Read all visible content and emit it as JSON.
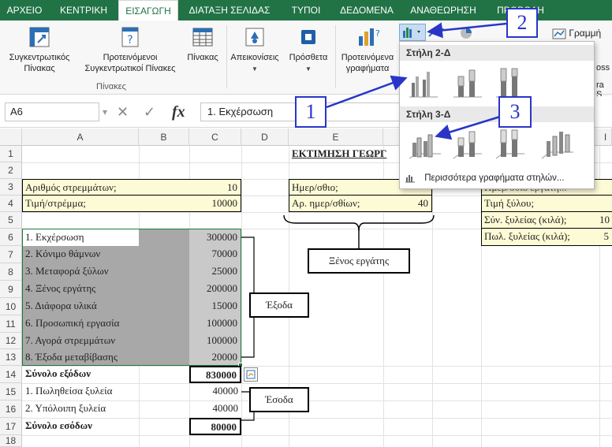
{
  "tabs": [
    {
      "label": "ΑΡΧΕΙΟ",
      "active": false
    },
    {
      "label": "ΚΕΝΤΡΙΚΗ",
      "active": false
    },
    {
      "label": "ΕΙΣΑΓΩΓΗ",
      "active": true
    },
    {
      "label": "ΔΙΑΤΑΞΗ ΣΕΛΙΔΑΣ",
      "active": false
    },
    {
      "label": "ΤΥΠΟΙ",
      "active": false
    },
    {
      "label": "ΔΕΔΟΜΕΝΑ",
      "active": false
    },
    {
      "label": "ΑΝΑΘΕΩΡΗΣΗ",
      "active": false
    },
    {
      "label": "ΠΡΟΒΟΛΗ",
      "active": false
    }
  ],
  "ribbon": {
    "pivot_line1": "Συγκεντρωτικός",
    "pivot_line2": "Πίνακας",
    "recpivot_line1": "Προτεινόμενοι",
    "recpivot_line2": "Συγκεντρωτικοί Πίνακες",
    "table_label": "Πίνακας",
    "tables_group": "Πίνακες",
    "illustrations_label": "Απεικονίσεις",
    "addins_label": "Πρόσθετα",
    "recchart_line1": "Προτεινόμενα",
    "recchart_line2": "γραφήματα",
    "line_chart_label": "Γραμμή",
    "cut_off_1": "oss",
    "cut_off_2": "ra S..."
  },
  "formula_bar": {
    "name_box": "A6",
    "fx": "fx",
    "cancel": "✕",
    "enter": "✓",
    "formula": "1. Εκχέρσωση"
  },
  "columns": [
    "A",
    "B",
    "C",
    "D",
    "E",
    "I"
  ],
  "rows": [
    "1",
    "2",
    "3",
    "4",
    "5",
    "6",
    "7",
    "8",
    "9",
    "10",
    "11",
    "12",
    "13",
    "14",
    "15",
    "16",
    "17",
    "18"
  ],
  "sheet": {
    "title": "ΕΚΤΙΜΗΣΗ ΓΕΩΡΓ",
    "area_label": "Αριθμός στρεμμάτων;",
    "area_value": "10",
    "price_label": "Τιμή/στρέμμα;",
    "price_value": "10000",
    "daily_label": "Ημερ/σθιο;",
    "days_label": "Αρ. ημερ/σθίων;",
    "days_value": "40",
    "right_r3": "Ημερ/σθιο εργάτη...",
    "right_r4": "Τιμή ξύλου;",
    "right_r5": "Σύν. ξυλείας (κιλά);",
    "right_r5_val": "10",
    "right_r6": "Πωλ. ξυλείας (κιλά);",
    "right_r6_val": "5",
    "expenses": [
      {
        "label": "1. Εκχέρσωση",
        "value": "300000"
      },
      {
        "label": "2. Κόνιμο θάμνων",
        "value": "70000"
      },
      {
        "label": "3. Μεταφορά ξύλων",
        "value": "25000"
      },
      {
        "label": "4. Ξένος εργάτης",
        "value": "200000"
      },
      {
        "label": "5. Διάφορα υλικά",
        "value": "15000"
      },
      {
        "label": "6. Προσωπική εργασία",
        "value": "100000"
      },
      {
        "label": "7. Αγορά στρεμμάτων",
        "value": "100000"
      },
      {
        "label": "8. Έξοδα μεταβίβασης",
        "value": "20000"
      }
    ],
    "total_exp_label": "Σύνολο εξόδων",
    "total_exp_value": "830000",
    "income": [
      {
        "label": "1. Πωληθείσα ξυλεία",
        "value": "40000"
      },
      {
        "label": "2. Υπόλοιπη ξυλεία",
        "value": "40000"
      }
    ],
    "total_inc_label": "Σύνολο εσόδων",
    "total_inc_value": "80000"
  },
  "dropdown": {
    "section_2d": "Στήλη 2-Δ",
    "section_3d": "Στήλη 3-Δ",
    "more_link": "Περισσότερα γραφήματα στηλών..."
  },
  "annotations": {
    "num1": "1",
    "num2": "2",
    "num3": "3",
    "foreign_worker": "Ξένος εργάτης",
    "expenses": "Έξοδα",
    "income": "Έσοδα"
  },
  "colors": {
    "accent": "#217346",
    "annotation_blue": "#2a35c8"
  }
}
